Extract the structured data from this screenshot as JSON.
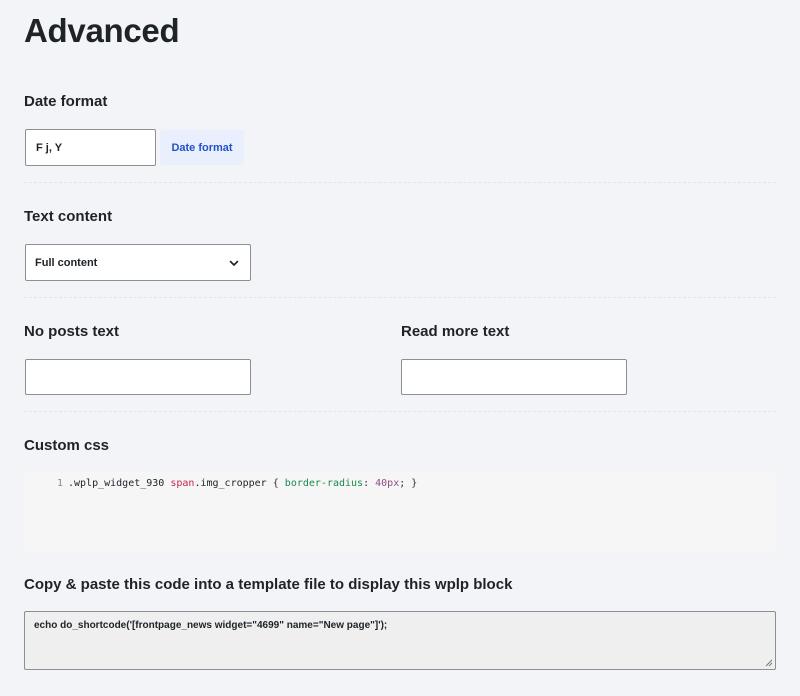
{
  "page_title": "Advanced",
  "date_format": {
    "label": "Date format",
    "value": "F j, Y",
    "tag": "Date format"
  },
  "text_content": {
    "label": "Text content",
    "selected": "Full content"
  },
  "no_posts_text": {
    "label": "No posts text",
    "value": ""
  },
  "read_more_text": {
    "label": "Read more text",
    "value": ""
  },
  "custom_css": {
    "label": "Custom css",
    "line_number": "1",
    "selector": ".wplp_widget_930",
    "tag": "span",
    "class_part": ".img_cropper",
    "open_brace": "{",
    "property": "border-radius",
    "colon": ":",
    "value_num": "40px",
    "semicolon_close": "; }"
  },
  "shortcode": {
    "label": "Copy & paste this code into a template file to display this wplp block",
    "code": "echo do_shortcode('[frontpage_news widget=\"4699\" name=\"New page\"]');"
  },
  "colors": {
    "background": "#f3f4f8",
    "accent": "#2452c9",
    "tag_bg": "#e9effc",
    "code_tag": "#c7254e",
    "code_prop": "#1a8a4a",
    "code_num": "#8c4b8a"
  }
}
